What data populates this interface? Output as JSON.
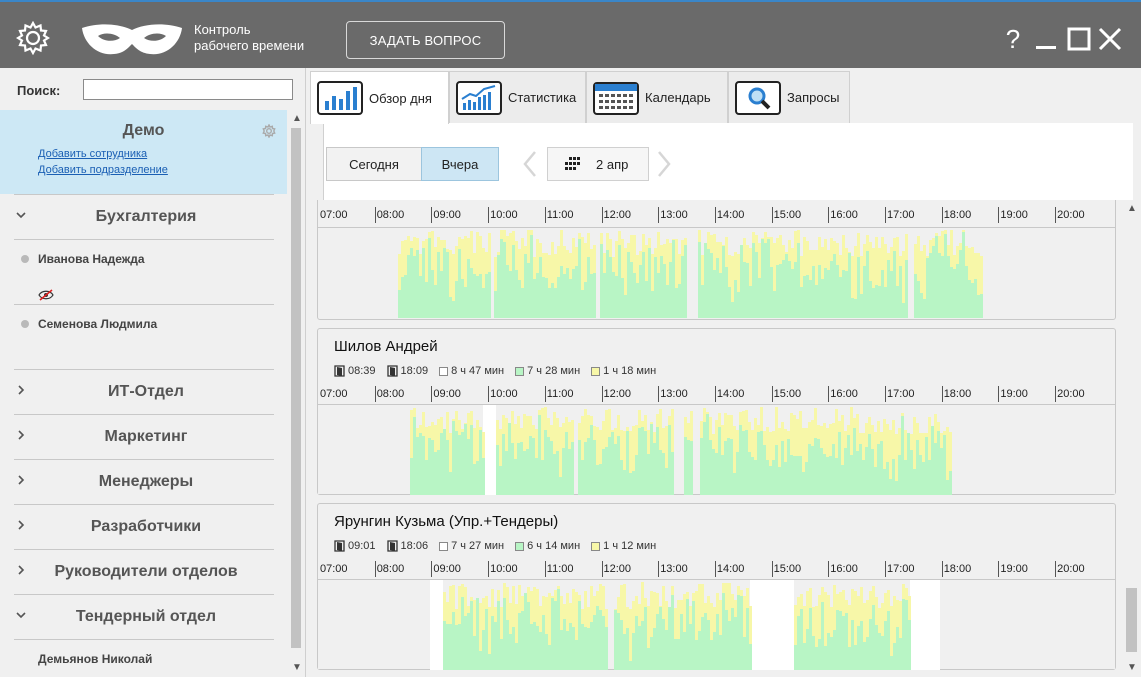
{
  "header": {
    "brand_line1": "Контроль",
    "brand_line2": "рабочего времени",
    "ask_button": "ЗАДАТЬ ВОПРОС",
    "help_label": "?",
    "accent_color": "#3a86c8",
    "bar_color": "#6a6a6a"
  },
  "sidebar": {
    "search_label": "Поиск:",
    "search_value": "",
    "company": "Демо",
    "add_employee": "Добавить сотрудника",
    "add_department": "Добавить подразделение",
    "groups": [
      {
        "name": "Бухгалтерия",
        "expanded": true
      },
      {
        "name": "ИТ-Отдел",
        "expanded": false
      },
      {
        "name": "Маркетинг",
        "expanded": false
      },
      {
        "name": "Менеджеры",
        "expanded": false
      },
      {
        "name": "Разработчики",
        "expanded": false
      },
      {
        "name": "Руководители отделов",
        "expanded": false
      },
      {
        "name": "Тендерный отдел",
        "expanded": true
      }
    ],
    "employees": [
      {
        "name": "Иванова Надежда"
      },
      {
        "name": "Семенова Людмила"
      },
      {
        "name": "Демьянов Николай"
      }
    ]
  },
  "tabs": [
    {
      "label": "Обзор дня",
      "icon": "bar-chart-icon",
      "active": true
    },
    {
      "label": "Статистика",
      "icon": "trend-chart-icon",
      "active": false
    },
    {
      "label": "Календарь",
      "icon": "calendar-icon",
      "active": false
    },
    {
      "label": "Запросы",
      "icon": "magnifier-icon",
      "active": false
    }
  ],
  "toolbar": {
    "today": "Сегодня",
    "yesterday": "Вчера",
    "selected": "Вчера",
    "date": "2 апр"
  },
  "colors": {
    "productive": "#b8f5c5",
    "neutral": "#f7f7a8",
    "selection": "#cde6f4"
  },
  "hours": [
    "07:00",
    "08:00",
    "09:00",
    "10:00",
    "11:00",
    "12:00",
    "13:00",
    "14:00",
    "15:00",
    "16:00",
    "17:00",
    "18:00",
    "19:00",
    "20:00"
  ],
  "employees_timeline": [
    {
      "name": "",
      "arrive": "",
      "leave": "",
      "total": "",
      "productive": "",
      "neutral": ""
    },
    {
      "name": "Шилов Андрей",
      "arrive": "08:39",
      "leave": "18:09",
      "total": "8 ч 47 мин",
      "productive": "7 ч 28 мин",
      "neutral": "1 ч 18 мин"
    },
    {
      "name": "Ярунгин Кузьма (Упр.+Тендеры)",
      "arrive": "09:01",
      "leave": "18:06",
      "total": "7 ч 27 мин",
      "productive": "6 ч 14 мин",
      "neutral": "1 ч 12 мин"
    }
  ]
}
